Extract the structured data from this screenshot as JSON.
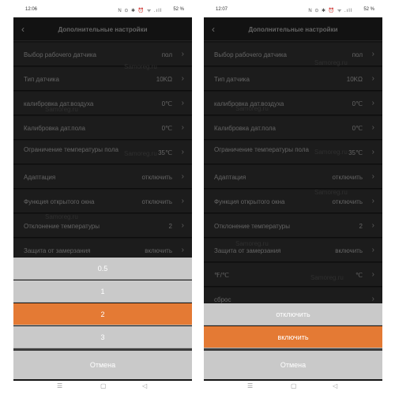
{
  "left": {
    "status": {
      "time": "12:06",
      "icons": "N ⊙ ✱ ⏰ ᯤ .ıll",
      "battery": "52 %"
    },
    "title": "Дополнительные настройки",
    "rows": [
      {
        "label": "Выбор рабочего датчика",
        "value": "пол"
      },
      {
        "label": "Тип датчика",
        "value": "10KΩ"
      },
      {
        "label": "калибровка дат.воздуха",
        "value": "0℃"
      },
      {
        "label": "Калибровка дат.пола",
        "value": "0℃"
      },
      {
        "label": "Ограничение температуры пола",
        "value": "35℃"
      },
      {
        "label": "Адаптация",
        "value": "отключить"
      },
      {
        "label": "Функция открытого окна",
        "value": "отключить"
      },
      {
        "label": "Отклонение температуры",
        "value": "2"
      },
      {
        "label": "Защита от замерзания",
        "value": "включить"
      }
    ],
    "sheet": {
      "options": [
        "0.5",
        "1",
        "2",
        "3"
      ],
      "selected_index": 2,
      "cancel": "Отмена"
    }
  },
  "right": {
    "status": {
      "time": "12:07",
      "icons": "N ⊙ ✱ ⏰ ᯤ .ıll",
      "battery": "52 %"
    },
    "title": "Дополнительные настройки",
    "rows": [
      {
        "label": "Выбор рабочего датчика",
        "value": "пол"
      },
      {
        "label": "Тип датчика",
        "value": "10KΩ"
      },
      {
        "label": "калибровка дат.воздуха",
        "value": "0℃"
      },
      {
        "label": "Калибровка дат.пола",
        "value": "0℃"
      },
      {
        "label": "Ограничение температуры пола",
        "value": "35℃"
      },
      {
        "label": "Адаптация",
        "value": "отключить"
      },
      {
        "label": "Функция открытого окна",
        "value": "отключить"
      },
      {
        "label": "Отклонение температуры",
        "value": "2"
      },
      {
        "label": "Защита от замерзания",
        "value": "включить"
      },
      {
        "label": "℉/℃",
        "value": "℃"
      },
      {
        "label": "сброс",
        "value": ""
      }
    ],
    "sheet": {
      "options": [
        "отключить",
        "включить"
      ],
      "selected_index": 1,
      "cancel": "Отмена"
    }
  },
  "watermark": "Samoreg.ru",
  "colors": {
    "accent": "#e47a34",
    "sheet_bg": "#c9c9c9",
    "list_bg": "#1a1a1a"
  },
  "nav_icons": [
    "menu-icon",
    "home-icon",
    "back-icon"
  ]
}
